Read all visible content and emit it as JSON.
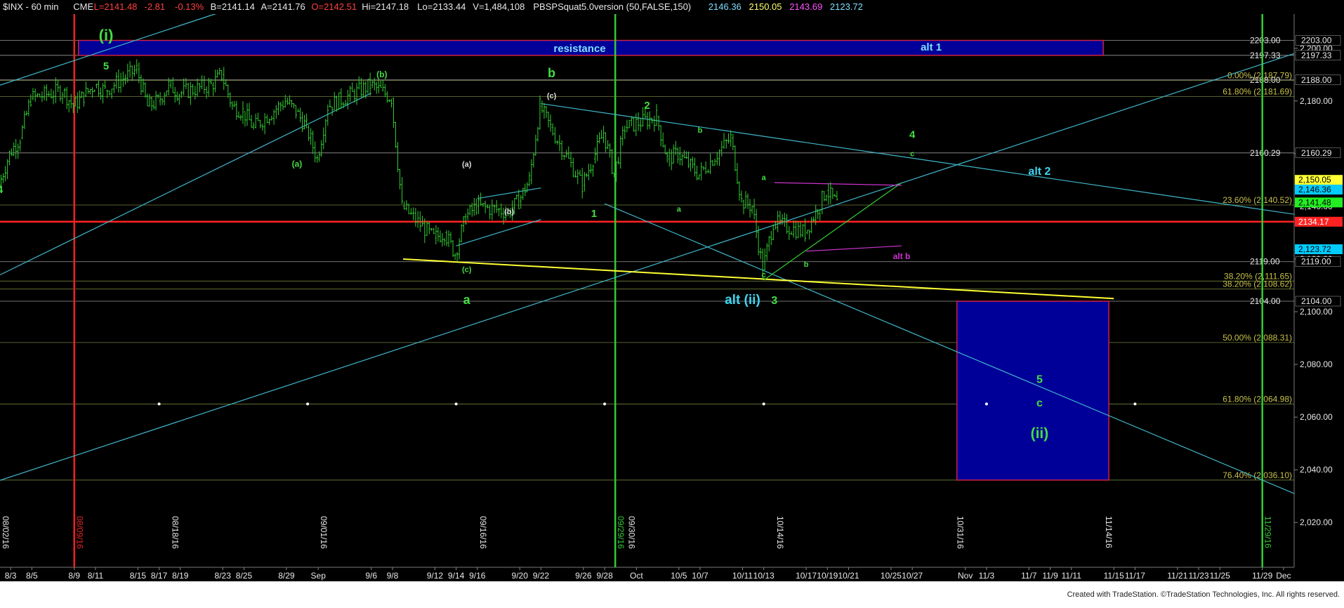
{
  "header": {
    "symbol": "$INX - 60 min",
    "exchange": "CME",
    "items": [
      {
        "text": "L=2141.48",
        "color": "#ff4040"
      },
      {
        "text": "-2.81",
        "color": "#ff4040"
      },
      {
        "text": "-0.13%",
        "color": "#ff4040"
      },
      {
        "text": "B=2141.14",
        "color": "#e8e8e8"
      },
      {
        "text": "A=2141.76",
        "color": "#e8e8e8"
      },
      {
        "text": "O=2142.51",
        "color": "#ff4040"
      },
      {
        "text": "Hi=2147.18",
        "color": "#e8e8e8"
      },
      {
        "text": "Lo=2133.44",
        "color": "#e8e8e8"
      },
      {
        "text": "V=1,484,108",
        "color": "#e8e8e8"
      },
      {
        "text": "PBSPSquat5.0version (50,FALSE,150)",
        "color": "#e8e8e8"
      },
      {
        "text": "2146.36",
        "color": "#7fdfff"
      },
      {
        "text": "2150.05",
        "color": "#ffff66"
      },
      {
        "text": "2143.69",
        "color": "#ff55ff"
      },
      {
        "text": "2123.72",
        "color": "#7fdfff"
      }
    ]
  },
  "footer": "Created with TradeStation. ©TradeStation Technologies, Inc. All rights reserved.",
  "colors": {
    "background": "#000000",
    "up_bar": "#33cc33",
    "down_bar": "#33cc33",
    "grid": "#2a2a2a",
    "trend": "#3fb7c9",
    "resistance_line": "#ff2222",
    "support_yellow": "#ffff33",
    "wave_green": "#44dd44",
    "wave_cyan": "#3fd5f2",
    "box_fill": "#000099",
    "box_border": "#cc2244"
  },
  "chart_data": {
    "type": "candlestick",
    "y_axis": {
      "range": [
        2003,
        2213
      ],
      "ticks": [
        "2,020.00",
        "2,040.00",
        "2,060.00",
        "2,080.00",
        "2,100.00",
        "2,120.00",
        "2,140.00",
        "2,160.00",
        "2,180.00",
        "2,200.00"
      ],
      "tick_values": [
        2020,
        2040,
        2060,
        2080,
        2100,
        2120,
        2140,
        2160,
        2180,
        2200
      ]
    },
    "x_axis": {
      "range": [
        "2016-08-02",
        "2016-12-02"
      ],
      "labels": [
        {
          "label": "8/3",
          "date": "2016-08-03"
        },
        {
          "label": "8/5",
          "date": "2016-08-05"
        },
        {
          "label": "8/9",
          "date": "2016-08-09"
        },
        {
          "label": "8/11",
          "date": "2016-08-11"
        },
        {
          "label": "8/15",
          "date": "2016-08-15"
        },
        {
          "label": "8/17",
          "date": "2016-08-17"
        },
        {
          "label": "8/19",
          "date": "2016-08-19"
        },
        {
          "label": "8/23",
          "date": "2016-08-23"
        },
        {
          "label": "8/25",
          "date": "2016-08-25"
        },
        {
          "label": "8/29",
          "date": "2016-08-29"
        },
        {
          "label": "Sep",
          "date": "2016-09-01"
        },
        {
          "label": "9/6",
          "date": "2016-09-06"
        },
        {
          "label": "9/8",
          "date": "2016-09-08"
        },
        {
          "label": "9/12",
          "date": "2016-09-12"
        },
        {
          "label": "9/14",
          "date": "2016-09-14"
        },
        {
          "label": "9/16",
          "date": "2016-09-16"
        },
        {
          "label": "9/20",
          "date": "2016-09-20"
        },
        {
          "label": "9/22",
          "date": "2016-09-22"
        },
        {
          "label": "9/26",
          "date": "2016-09-26"
        },
        {
          "label": "9/28",
          "date": "2016-09-28"
        },
        {
          "label": "Oct",
          "date": "2016-10-01"
        },
        {
          "label": "10/5",
          "date": "2016-10-05"
        },
        {
          "label": "10/7",
          "date": "2016-10-07"
        },
        {
          "label": "10/11",
          "date": "2016-10-11"
        },
        {
          "label": "10/13",
          "date": "2016-10-13"
        },
        {
          "label": "10/17",
          "date": "2016-10-17"
        },
        {
          "label": "10/19",
          "date": "2016-10-19"
        },
        {
          "label": "10/21",
          "date": "2016-10-21"
        },
        {
          "label": "10/25",
          "date": "2016-10-25"
        },
        {
          "label": "10/27",
          "date": "2016-10-27"
        },
        {
          "label": "Nov",
          "date": "2016-11-01"
        },
        {
          "label": "11/3",
          "date": "2016-11-03"
        },
        {
          "label": "11/7",
          "date": "2016-11-07"
        },
        {
          "label": "11/9",
          "date": "2016-11-09"
        },
        {
          "label": "11/11",
          "date": "2016-11-11"
        },
        {
          "label": "11/15",
          "date": "2016-11-15"
        },
        {
          "label": "11/17",
          "date": "2016-11-17"
        },
        {
          "label": "11/21",
          "date": "2016-11-21"
        },
        {
          "label": "11/23",
          "date": "2016-11-23"
        },
        {
          "label": "11/25",
          "date": "2016-11-25"
        },
        {
          "label": "11/29",
          "date": "2016-11-29"
        },
        {
          "label": "Dec",
          "date": "2016-12-01"
        }
      ]
    },
    "price_path": [
      [
        "2016-08-02",
        2148
      ],
      [
        "2016-08-03",
        2160
      ],
      [
        "2016-08-04",
        2166
      ],
      [
        "2016-08-05",
        2181
      ],
      [
        "2016-08-08",
        2184
      ],
      [
        "2016-08-09",
        2178
      ],
      [
        "2016-08-10",
        2182
      ],
      [
        "2016-08-11",
        2186
      ],
      [
        "2016-08-12",
        2184
      ],
      [
        "2016-08-15",
        2192
      ],
      [
        "2016-08-16",
        2178
      ],
      [
        "2016-08-17",
        2180
      ],
      [
        "2016-08-18",
        2186
      ],
      [
        "2016-08-19",
        2183
      ],
      [
        "2016-08-22",
        2186
      ],
      [
        "2016-08-23",
        2190
      ],
      [
        "2016-08-24",
        2178
      ],
      [
        "2016-08-25",
        2176
      ],
      [
        "2016-08-26",
        2170
      ],
      [
        "2016-08-29",
        2180
      ],
      [
        "2016-08-30",
        2176
      ],
      [
        "2016-08-31",
        2170
      ],
      [
        "2016-09-01",
        2158
      ],
      [
        "2016-09-02",
        2178
      ],
      [
        "2016-09-06",
        2186
      ],
      [
        "2016-09-07",
        2184
      ],
      [
        "2016-09-08",
        2181
      ],
      [
        "2016-09-09",
        2140
      ],
      [
        "2016-09-12",
        2128
      ],
      [
        "2016-09-13",
        2130
      ],
      [
        "2016-09-14",
        2122
      ],
      [
        "2016-09-15",
        2136
      ],
      [
        "2016-09-16",
        2140
      ],
      [
        "2016-09-19",
        2138
      ],
      [
        "2016-09-20",
        2142
      ],
      [
        "2016-09-21",
        2150
      ],
      [
        "2016-09-22",
        2178
      ],
      [
        "2016-09-23",
        2170
      ],
      [
        "2016-09-26",
        2148
      ],
      [
        "2016-09-27",
        2158
      ],
      [
        "2016-09-28",
        2168
      ],
      [
        "2016-09-29",
        2152
      ],
      [
        "2016-09-30",
        2170
      ],
      [
        "2016-10-03",
        2174
      ],
      [
        "2016-10-04",
        2158
      ],
      [
        "2016-10-05",
        2160
      ],
      [
        "2016-10-06",
        2156
      ],
      [
        "2016-10-07",
        2152
      ],
      [
        "2016-10-10",
        2166
      ],
      [
        "2016-10-11",
        2142
      ],
      [
        "2016-10-12",
        2140
      ],
      [
        "2016-10-13",
        2116
      ],
      [
        "2016-10-14",
        2134
      ],
      [
        "2016-10-17",
        2130
      ],
      [
        "2016-10-18",
        2138
      ],
      [
        "2016-10-19",
        2146
      ],
      [
        "2016-10-20",
        2141
      ]
    ],
    "horizontal_lines": [
      {
        "value": 2203.0,
        "label": "2203.00",
        "color": "#cccccc"
      },
      {
        "value": 2197.33,
        "label": "2197.33",
        "color": "#cccccc"
      },
      {
        "value": 2188.0,
        "label": "2188.00",
        "color": "#cccccc"
      },
      {
        "value": 2160.29,
        "label": "2160.29",
        "color": "#cccccc"
      },
      {
        "value": 2119.0,
        "label": "2119.00",
        "color": "#cccccc"
      },
      {
        "value": 2104.0,
        "label": "2104.00",
        "color": "#cccccc"
      },
      {
        "value": 2134.17,
        "label": "2134.17",
        "color": "#ff2222"
      }
    ],
    "fib_levels": [
      {
        "value": 2187.79,
        "label": "0.00% (2,187.79)"
      },
      {
        "value": 2181.69,
        "label": "61.80% (2,181.69)"
      },
      {
        "value": 2140.52,
        "label": "23.60% (2,140.52)"
      },
      {
        "value": 2111.65,
        "label": "38.20% (2,111.65)"
      },
      {
        "value": 2108.62,
        "label": "38.20% (2,108.62)"
      },
      {
        "value": 2088.31,
        "label": "50.00% (2,088.31)"
      },
      {
        "value": 2064.98,
        "label": "61.80% (2,064.98)"
      },
      {
        "value": 2036.1,
        "label": "76.40% (2,036.10)"
      }
    ],
    "price_tags": [
      {
        "value": 2150.05,
        "label": "2,150.05",
        "bg": "#ffff33"
      },
      {
        "value": 2146.36,
        "label": "2,146.36",
        "bg": "#00ccff"
      },
      {
        "value": 2141.48,
        "label": "2,141.48",
        "bg": "#22ee22"
      },
      {
        "value": 2134.17,
        "label": "2134.17",
        "bg": "#ff2222"
      },
      {
        "value": 2123.72,
        "label": "2,123.72",
        "bg": "#00ccff"
      }
    ],
    "vertical_lines": [
      {
        "date": "2016-08-09",
        "label": "08/09/16",
        "color": "#ee2222"
      },
      {
        "date": "2016-09-29",
        "label": "09/29/16",
        "color": "#33cc33"
      },
      {
        "date": "2016-11-29",
        "label": "11/29/16",
        "color": "#33cc33"
      }
    ],
    "date_labels": [
      {
        "date": "2016-08-02",
        "label": "08/02/16"
      },
      {
        "date": "2016-08-18",
        "label": "08/18/16"
      },
      {
        "date": "2016-09-01",
        "label": "09/01/16"
      },
      {
        "date": "2016-09-16",
        "label": "09/16/16"
      },
      {
        "date": "2016-09-30",
        "label": "09/30/16"
      },
      {
        "date": "2016-10-14",
        "label": "10/14/16"
      },
      {
        "date": "2016-10-31",
        "label": "10/31/16"
      },
      {
        "date": "2016-11-14",
        "label": "11/14/16"
      }
    ],
    "dot_row": {
      "value": 2065,
      "dates": [
        "2016-08-17",
        "2016-08-31",
        "2016-09-14",
        "2016-09-28",
        "2016-10-13",
        "2016-11-03",
        "2016-11-17"
      ]
    },
    "resistance_box": {
      "x0": "2016-08-09",
      "x1": "2016-11-14",
      "y0": 2197.33,
      "y1": 2203.0,
      "label": "resistance",
      "alt_label": "alt 1"
    },
    "target_box": {
      "x0": "2016-11-01",
      "x1": "2016-11-14",
      "y0": 2036.1,
      "y1": 2104.0
    },
    "trendlines": [
      {
        "from": [
          "2016-08-02",
          2036
        ],
        "to": [
          "2016-12-02",
          2198
        ],
        "color": "#3fb7c9"
      },
      {
        "from": [
          "2016-08-02",
          2114
        ],
        "to": [
          "2016-09-06",
          2183
        ],
        "color": "#3fb7c9"
      },
      {
        "from": [
          "2016-08-02",
          2186
        ],
        "to": [
          "2016-08-23",
          2214
        ],
        "color": "#3fb7c9"
      },
      {
        "from": [
          "2016-09-22",
          2179
        ],
        "to": [
          "2016-12-02",
          2137
        ],
        "color": "#3fb7c9"
      },
      {
        "from": [
          "2016-09-28",
          2141
        ],
        "to": [
          "2016-12-02",
          2031
        ],
        "color": "#3fb7c9"
      },
      {
        "from": [
          "2016-09-14",
          2125
        ],
        "to": [
          "2016-09-22",
          2135
        ],
        "color": "#3fb7c9"
      },
      {
        "from": [
          "2016-09-16",
          2143
        ],
        "to": [
          "2016-09-22",
          2147
        ],
        "color": "#3fb7c9"
      },
      {
        "from": [
          "2016-09-09",
          2120
        ],
        "to": [
          "2016-11-15",
          2105
        ],
        "color": "#ffff33"
      },
      {
        "from": [
          "2016-10-13",
          2112
        ],
        "to": [
          "2016-10-26",
          2149
        ],
        "color": "#33cc33"
      },
      {
        "from": [
          "2016-10-14",
          2149
        ],
        "to": [
          "2016-10-26",
          2148
        ],
        "color": "#cc33cc"
      },
      {
        "from": [
          "2016-10-17",
          2123
        ],
        "to": [
          "2016-10-26",
          2125
        ],
        "color": "#cc33cc"
      }
    ],
    "annotations": [
      {
        "text": "(i)",
        "date": "2016-08-12",
        "value": 2203,
        "color": "#44dd44",
        "size": 22
      },
      {
        "text": "5",
        "date": "2016-08-12",
        "value": 2192,
        "color": "#44dd44",
        "size": 15
      },
      {
        "text": "4",
        "date": "2016-08-02",
        "value": 2145,
        "color": "#44dd44",
        "size": 15
      },
      {
        "text": "(a)",
        "date": "2016-08-30",
        "value": 2155,
        "color": "#44dd44",
        "size": 12
      },
      {
        "text": "(b)",
        "date": "2016-09-07",
        "value": 2189,
        "color": "#44dd44",
        "size": 12
      },
      {
        "text": "b",
        "date": "2016-09-23",
        "value": 2189,
        "color": "#44dd44",
        "size": 18
      },
      {
        "text": "(c)",
        "date": "2016-09-23",
        "value": 2181,
        "color": "#dddddd",
        "size": 11
      },
      {
        "text": "(a)",
        "date": "2016-09-15",
        "value": 2155,
        "color": "#dddddd",
        "size": 11
      },
      {
        "text": "(b)",
        "date": "2016-09-19",
        "value": 2137,
        "color": "#dddddd",
        "size": 11
      },
      {
        "text": "(c)",
        "date": "2016-09-15",
        "value": 2115,
        "color": "#44dd44",
        "size": 11
      },
      {
        "text": "a",
        "date": "2016-09-15",
        "value": 2103,
        "color": "#44dd44",
        "size": 18
      },
      {
        "text": "1",
        "date": "2016-09-27",
        "value": 2136,
        "color": "#44dd44",
        "size": 15
      },
      {
        "text": "2",
        "date": "2016-10-02",
        "value": 2177,
        "color": "#44dd44",
        "size": 15
      },
      {
        "text": "a",
        "date": "2016-10-05",
        "value": 2138,
        "color": "#44dd44",
        "size": 11
      },
      {
        "text": "b",
        "date": "2016-10-07",
        "value": 2168,
        "color": "#44dd44",
        "size": 11
      },
      {
        "text": "a",
        "date": "2016-10-13",
        "value": 2150,
        "color": "#44dd44",
        "size": 11
      },
      {
        "text": "c",
        "date": "2016-10-13",
        "value": 2113,
        "color": "#44dd44",
        "size": 11
      },
      {
        "text": "b",
        "date": "2016-10-17",
        "value": 2117,
        "color": "#44dd44",
        "size": 11
      },
      {
        "text": "alt (ii)",
        "date": "2016-10-11",
        "value": 2103,
        "color": "#3fd5f2",
        "size": 19
      },
      {
        "text": "3",
        "date": "2016-10-14",
        "value": 2103,
        "color": "#44dd44",
        "size": 16
      },
      {
        "text": "4",
        "date": "2016-10-27",
        "value": 2166,
        "color": "#44dd44",
        "size": 15
      },
      {
        "text": "c",
        "date": "2016-10-27",
        "value": 2159,
        "color": "#44dd44",
        "size": 11
      },
      {
        "text": "alt b",
        "date": "2016-10-26",
        "value": 2120,
        "color": "#cc33cc",
        "size": 12
      },
      {
        "text": "alt 2",
        "date": "2016-11-08",
        "value": 2152,
        "color": "#3fd5f2",
        "size": 16
      },
      {
        "text": "5",
        "date": "2016-11-08",
        "value": 2073,
        "color": "#44dd44",
        "size": 16
      },
      {
        "text": "c",
        "date": "2016-11-08",
        "value": 2064,
        "color": "#44dd44",
        "size": 16
      },
      {
        "text": "(ii)",
        "date": "2016-11-08",
        "value": 2052,
        "color": "#44dd44",
        "size": 21
      }
    ]
  }
}
